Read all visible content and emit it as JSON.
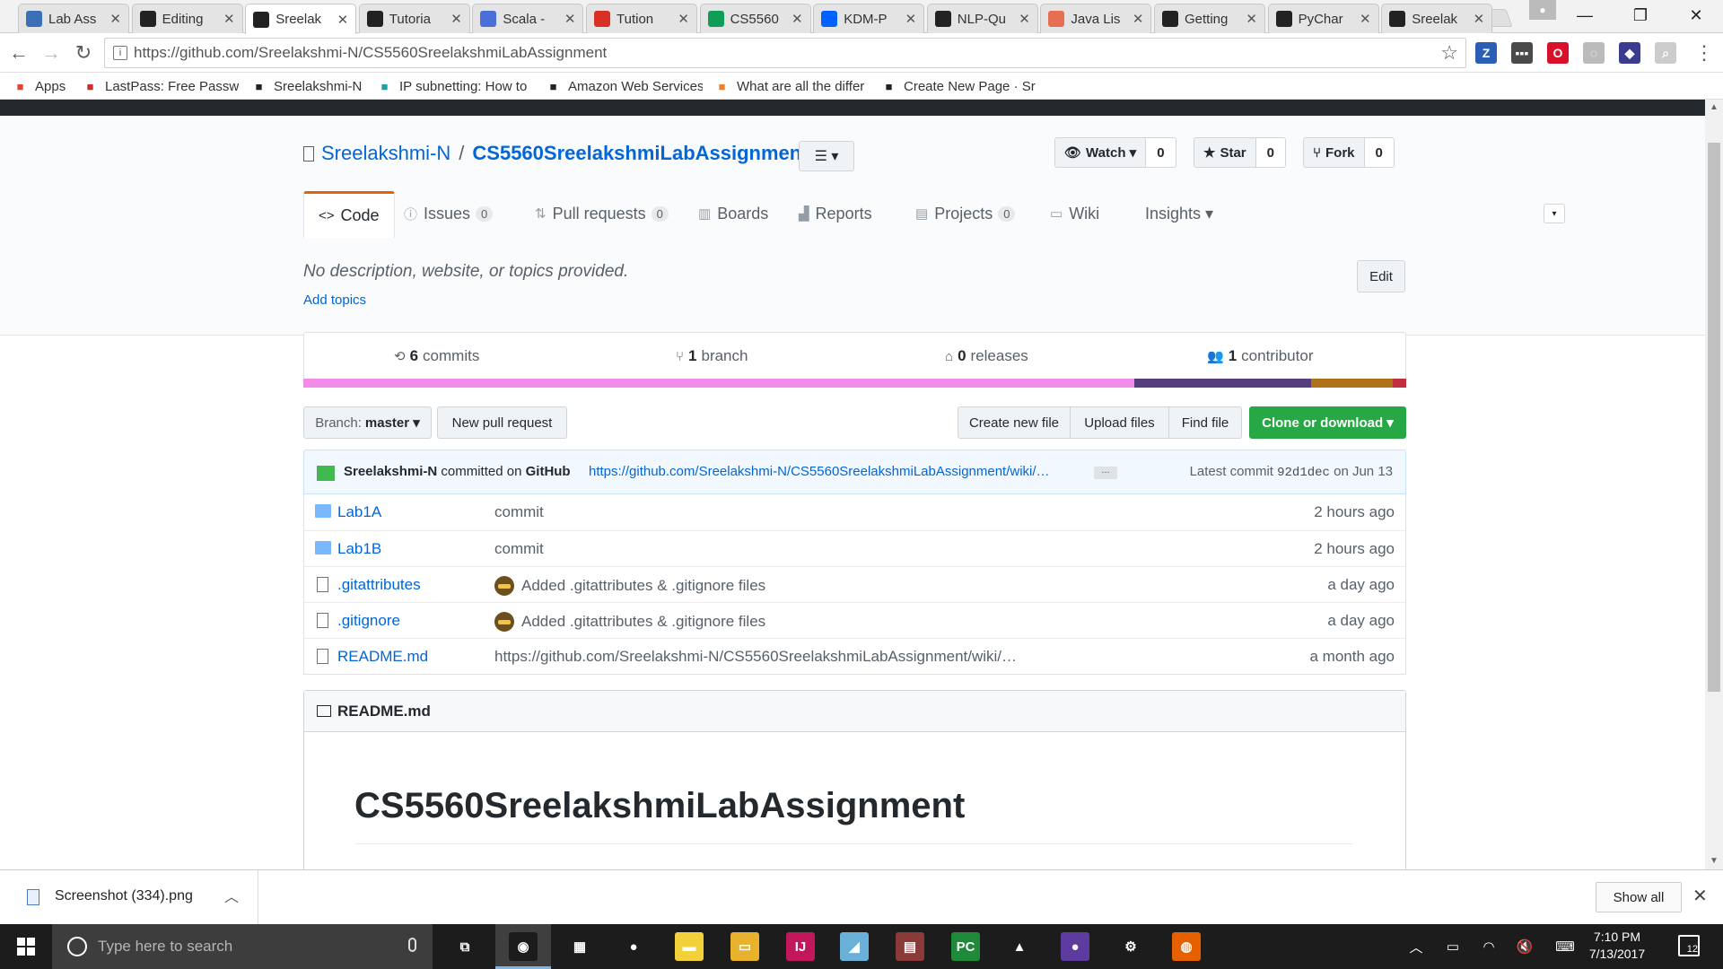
{
  "browser": {
    "tabs": [
      {
        "label": "Lab Ass",
        "icon": "b-icon",
        "color": "#3b6fb6"
      },
      {
        "label": "Editing",
        "icon": "github-icon",
        "color": "#222222"
      },
      {
        "label": "Sreelak",
        "icon": "github-icon",
        "color": "#222222",
        "active": true
      },
      {
        "label": "Tutoria",
        "icon": "github-icon",
        "color": "#222222"
      },
      {
        "label": "Scala -",
        "icon": "a-icon",
        "color": "#4a6fd8"
      },
      {
        "label": "Tution",
        "icon": "gmail-icon",
        "color": "#d93025"
      },
      {
        "label": "CS5560",
        "icon": "sheets-icon",
        "color": "#0f9d58"
      },
      {
        "label": "KDM-P",
        "icon": "dropbox-icon",
        "color": "#0061fe"
      },
      {
        "label": "NLP-Qu",
        "icon": "github-icon",
        "color": "#222222"
      },
      {
        "label": "Java Lis",
        "icon": "j-icon",
        "color": "#e76f51"
      },
      {
        "label": "Getting",
        "icon": "jetbrains-icon",
        "color": "#222222"
      },
      {
        "label": "PyChar",
        "icon": "jetbrains-icon",
        "color": "#222222"
      },
      {
        "label": "Sreelak",
        "icon": "github-icon",
        "color": "#222222"
      }
    ],
    "url": "https://github.com/Sreelakshmi-N/CS5560SreelakshmiLabAssignment",
    "extensions": [
      {
        "label": "Z",
        "color": "#2b5fb4"
      },
      {
        "label": "▪▪▪",
        "color": "#4a4a4a"
      },
      {
        "label": "O",
        "color": "#d8102a"
      },
      {
        "label": "◌",
        "color": "#bbbbbb"
      },
      {
        "label": "◆",
        "color": "#3b3b8f"
      },
      {
        "label": "⌕",
        "color": "#cccccc"
      }
    ],
    "bookmarks": [
      {
        "label": "Apps",
        "icon": "apps-grid-icon",
        "color": "#e94235"
      },
      {
        "label": "LastPass: Free Passwo",
        "icon": "lastpass-icon",
        "color": "#cc2d2d"
      },
      {
        "label": "Sreelakshmi-N",
        "icon": "github-icon",
        "color": "#222222"
      },
      {
        "label": "IP subnetting: How to",
        "icon": "site-icon",
        "color": "#1aa39a"
      },
      {
        "label": "Amazon Web Services",
        "icon": "amazon-icon",
        "color": "#222222"
      },
      {
        "label": "What are all the differ",
        "icon": "so-icon",
        "color": "#f48024"
      },
      {
        "label": "Create New Page · Sr",
        "icon": "github-icon",
        "color": "#222222"
      }
    ]
  },
  "repo": {
    "owner": "Sreelakshmi-N",
    "separator": "/",
    "name": "CS5560SreelakshmiLabAssignment",
    "watch_label": "Watch ▾",
    "watch_count": "0",
    "star_label": "Star",
    "star_count": "0",
    "fork_label": "Fork",
    "fork_count": "0",
    "nav": [
      {
        "label": "Code",
        "icon": "code-icon",
        "selected": true
      },
      {
        "label": "Issues",
        "icon": "issue-icon",
        "counter": "0"
      },
      {
        "label": "Pull requests",
        "icon": "pull-request-icon",
        "counter": "0"
      },
      {
        "label": "Boards",
        "icon": "boards-icon"
      },
      {
        "label": "Reports",
        "icon": "reports-icon"
      },
      {
        "label": "Projects",
        "icon": "project-icon",
        "counter": "0"
      },
      {
        "label": "Wiki",
        "icon": "wiki-icon"
      },
      {
        "label": "Insights ▾",
        "icon": ""
      }
    ],
    "description": "No description, website, or topics provided.",
    "add_topics": "Add topics",
    "edit_label": "Edit",
    "summary": {
      "commits_num": "6",
      "commits_label": "commits",
      "branch_num": "1",
      "branch_label": "branch",
      "releases_num": "0",
      "releases_label": "releases",
      "contributors_num": "1",
      "contributors_label": "contributor"
    },
    "languages": [
      {
        "color": "#f18de8",
        "share": 0.61
      },
      {
        "color": "#563d7c",
        "share": 0.13
      },
      {
        "color": "#b07219",
        "share": 0.06
      },
      {
        "color": "#c22d40",
        "share": 0.01
      }
    ],
    "branch_button": {
      "prefix": "Branch:",
      "value": "master ▾"
    },
    "new_pr_label": "New pull request",
    "create_file_label": "Create new file",
    "upload_label": "Upload files",
    "find_label": "Find file",
    "clone_label": "Clone or download ▾",
    "commit": {
      "author": "Sreelakshmi-N",
      "committed_on": "committed on",
      "via": "GitHub",
      "message": "https://github.com/Sreelakshmi-N/CS5560SreelakshmiLabAssignment/wiki/…",
      "ellipsis": "…",
      "latest_prefix": "Latest commit",
      "sha": "92d1dec",
      "date": "on Jun 13"
    },
    "files": [
      {
        "name": "Lab1A",
        "type": "dir",
        "message": "commit",
        "age": "2 hours ago"
      },
      {
        "name": "Lab1B",
        "type": "dir",
        "message": "commit",
        "age": "2 hours ago"
      },
      {
        "name": ".gitattributes",
        "type": "file",
        "message": "Added .gitattributes & .gitignore files",
        "age": "a day ago",
        "emoji": true
      },
      {
        "name": ".gitignore",
        "type": "file",
        "message": "Added .gitattributes & .gitignore files",
        "age": "a day ago",
        "emoji": true
      },
      {
        "name": "README.md",
        "type": "file",
        "message": "https://github.com/Sreelakshmi-N/CS5560SreelakshmiLabAssignment/wiki/…",
        "age": "a month ago"
      }
    ],
    "readme": {
      "filename": "README.md",
      "heading": "CS5560SreelakshmiLabAssignment"
    }
  },
  "downloads": {
    "filename": "Screenshot (334).png",
    "show_all": "Show all"
  },
  "taskbar": {
    "search_placeholder": "Type here to search",
    "time": "7:10 PM",
    "date": "7/13/2017",
    "notifications": "12",
    "apps": [
      {
        "label": "⧉",
        "color": "#1c1c1c",
        "name": "task-view-icon"
      },
      {
        "label": "◉",
        "color": "#1c1c1c",
        "name": "chrome-icon"
      },
      {
        "label": "▦",
        "color": "#1c1c1c",
        "name": "store-icon"
      },
      {
        "label": "●",
        "color": "#1c1c1c",
        "name": "eclipse-icon"
      },
      {
        "label": "▬",
        "color": "#f2d13b",
        "name": "sticky-notes-icon"
      },
      {
        "label": "▭",
        "color": "#e8b22c",
        "name": "file-explorer-icon"
      },
      {
        "label": "IJ",
        "color": "#c2185b",
        "name": "intellij-icon"
      },
      {
        "label": "◢",
        "color": "#6ab0d8",
        "name": "app-icon"
      },
      {
        "label": "▤",
        "color": "#8b3a3a",
        "name": "winrar-icon"
      },
      {
        "label": "PC",
        "color": "#1f8a3a",
        "name": "pycharm-icon"
      },
      {
        "label": "▲",
        "color": "#1c1c1c",
        "name": "photos-icon"
      },
      {
        "label": "●",
        "color": "#5e3b9e",
        "name": "github-desktop-icon"
      },
      {
        "label": "⚙",
        "color": "#1c1c1c",
        "name": "settings-icon"
      },
      {
        "label": "◍",
        "color": "#e66000",
        "name": "firefox-icon"
      }
    ]
  }
}
